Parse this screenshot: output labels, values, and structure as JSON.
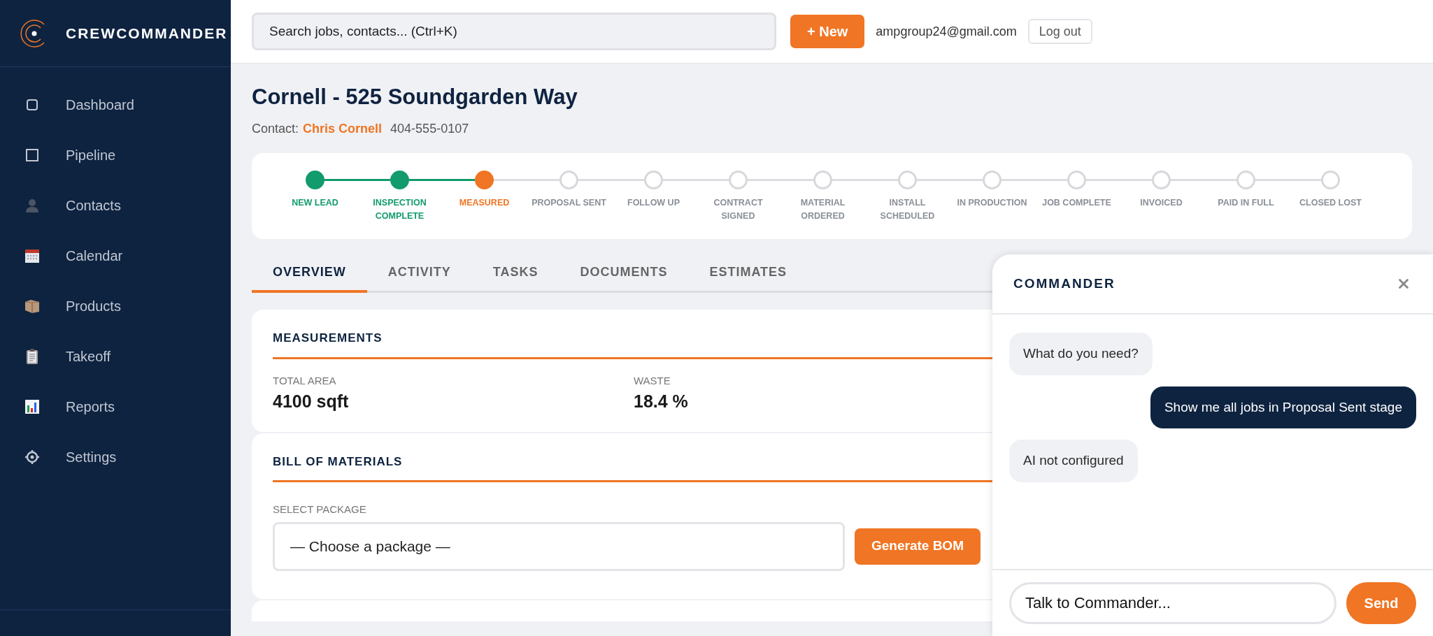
{
  "brand": {
    "name": "CREWCOMMANDER"
  },
  "sidebar": {
    "items": [
      {
        "label": "Dashboard"
      },
      {
        "label": "Pipeline"
      },
      {
        "label": "Contacts"
      },
      {
        "label": "Calendar"
      },
      {
        "label": "Products"
      },
      {
        "label": "Takeoff"
      },
      {
        "label": "Reports"
      },
      {
        "label": "Settings"
      }
    ]
  },
  "header": {
    "search": {
      "placeholder": "Search jobs, contacts... (Ctrl+K)"
    },
    "new_button": "+ New",
    "user_email": "ampgroup24@gmail.com",
    "logout": "Log out"
  },
  "job": {
    "title": "Cornell - 525 Soundgarden Way",
    "contact_label": "Contact:",
    "contact_name": "Chris Cornell",
    "phone": "404-555-0107"
  },
  "pipeline": {
    "stages": [
      {
        "label": "NEW LEAD",
        "completed": true,
        "current": false
      },
      {
        "label": "INSPECTION COMPLETE",
        "completed": true,
        "current": false
      },
      {
        "label": "MEASURED",
        "completed": false,
        "current": true
      },
      {
        "label": "PROPOSAL SENT",
        "completed": false,
        "current": false
      },
      {
        "label": "FOLLOW UP",
        "completed": false,
        "current": false
      },
      {
        "label": "CONTRACT SIGNED",
        "completed": false,
        "current": false
      },
      {
        "label": "MATERIAL ORDERED",
        "completed": false,
        "current": false
      },
      {
        "label": "INSTALL SCHEDULED",
        "completed": false,
        "current": false
      },
      {
        "label": "IN PRODUCTION",
        "completed": false,
        "current": false
      },
      {
        "label": "JOB COMPLETE",
        "completed": false,
        "current": false
      },
      {
        "label": "INVOICED",
        "completed": false,
        "current": false
      },
      {
        "label": "PAID IN FULL",
        "completed": false,
        "current": false
      },
      {
        "label": "CLOSED LOST",
        "completed": false,
        "current": false
      }
    ]
  },
  "tabs": [
    {
      "label": "OVERVIEW",
      "selected": true
    },
    {
      "label": "ACTIVITY",
      "selected": false
    },
    {
      "label": "TASKS",
      "selected": false
    },
    {
      "label": "DOCUMENTS",
      "selected": false
    },
    {
      "label": "ESTIMATES",
      "selected": false
    }
  ],
  "measurements": {
    "title": "MEASUREMENTS",
    "fields": [
      {
        "label": "TOTAL AREA",
        "value": "4100 sqft"
      },
      {
        "label": "WASTE",
        "value": "18.4 %"
      }
    ]
  },
  "bom": {
    "title": "BILL OF MATERIALS",
    "select_label": "SELECT PACKAGE",
    "select_value": "— Choose a package —",
    "button": "Generate BOM"
  },
  "chat": {
    "title": "COMMANDER",
    "messages": [
      {
        "kind": "incoming",
        "text": "What do you need?"
      },
      {
        "kind": "outgoing",
        "text": "Show me all jobs in Proposal Sent stage"
      },
      {
        "kind": "incoming",
        "text": "AI not configured"
      }
    ],
    "input": {
      "placeholder": "Talk to Commander..."
    },
    "send": "Send"
  }
}
